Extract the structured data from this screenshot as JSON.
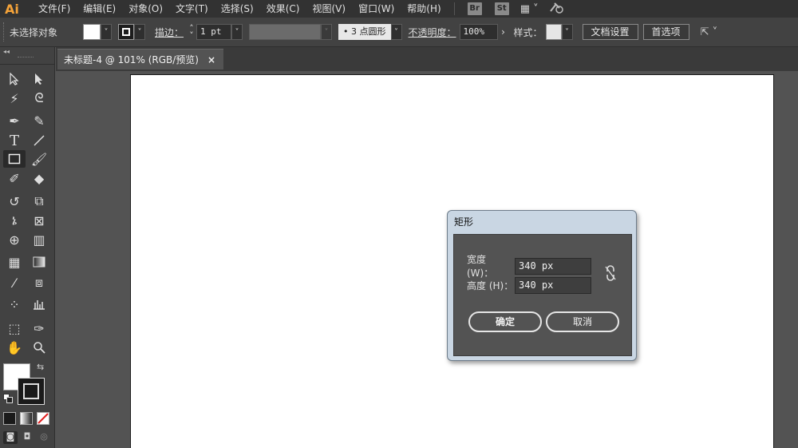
{
  "app": {
    "logo": "Ai"
  },
  "menu": {
    "items": [
      "文件(F)",
      "编辑(E)",
      "对象(O)",
      "文字(T)",
      "选择(S)",
      "效果(C)",
      "视图(V)",
      "窗口(W)",
      "帮助(H)"
    ],
    "badges": [
      "Br",
      "St"
    ]
  },
  "control": {
    "selection": "未选择对象",
    "stroke_label": "描边：",
    "stroke_weight": "1 pt",
    "profile": "• 3 点圆形",
    "opacity_label": "不透明度：",
    "opacity_value": "100%",
    "style_label": "样式：",
    "doc_setup": "文档设置",
    "preferences": "首选项"
  },
  "document": {
    "tab_title": "未标题-4 @ 101% (RGB/预览)",
    "close": "×"
  },
  "dialog": {
    "title": "矩形",
    "width_label": "宽度 (W)：",
    "width_value": "340 px",
    "height_label": "高度 (H)：",
    "height_value": "340 px",
    "ok": "确定",
    "cancel": "取消"
  },
  "colors": {
    "accent": "#f5a339",
    "chrome": "#424242",
    "canvas": "#535353",
    "dialog_frame": "#c9d6e3"
  }
}
